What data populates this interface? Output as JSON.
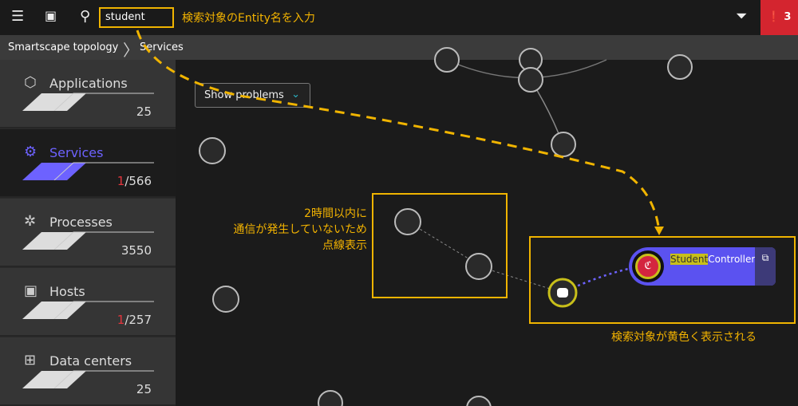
{
  "topbar": {
    "menu_icon": "hamburger-icon",
    "dashboard_icon": "monitor-icon",
    "search_icon": "search-icon",
    "search_value": "student",
    "filter_icon": "filter-icon",
    "problems_icon": "alert-icon",
    "problems_count": "3"
  },
  "breadcrumb": {
    "items": [
      "Smartscape topology",
      "Services"
    ]
  },
  "sidebar": {
    "items": [
      {
        "label": "Applications",
        "icon": "hexagon-icon",
        "count": "25",
        "problem": ""
      },
      {
        "label": "Services",
        "icon": "gear-icon",
        "count": "/566",
        "problem": "1",
        "selected": true
      },
      {
        "label": "Processes",
        "icon": "processes-icon",
        "count": "3550",
        "problem": ""
      },
      {
        "label": "Hosts",
        "icon": "host-icon",
        "count": "/257",
        "problem": "1"
      },
      {
        "label": "Data centers",
        "icon": "datacenter-icon",
        "count": "25",
        "problem": ""
      }
    ]
  },
  "canvas": {
    "show_problems": "Show problems",
    "service": {
      "highlight": "Student",
      "rest": "Controller"
    }
  },
  "annotations": {
    "search": "検索対象のEntity名を入力",
    "dotted": [
      "2時間以内に",
      "通信が発生していないため",
      "点線表示"
    ],
    "yellow": "検索対象が黄色く表示される"
  },
  "colors": {
    "accent": "#5b52f0",
    "annotation": "#f0b400",
    "problem": "#d4252f",
    "highlight": "#c8bf1a"
  }
}
